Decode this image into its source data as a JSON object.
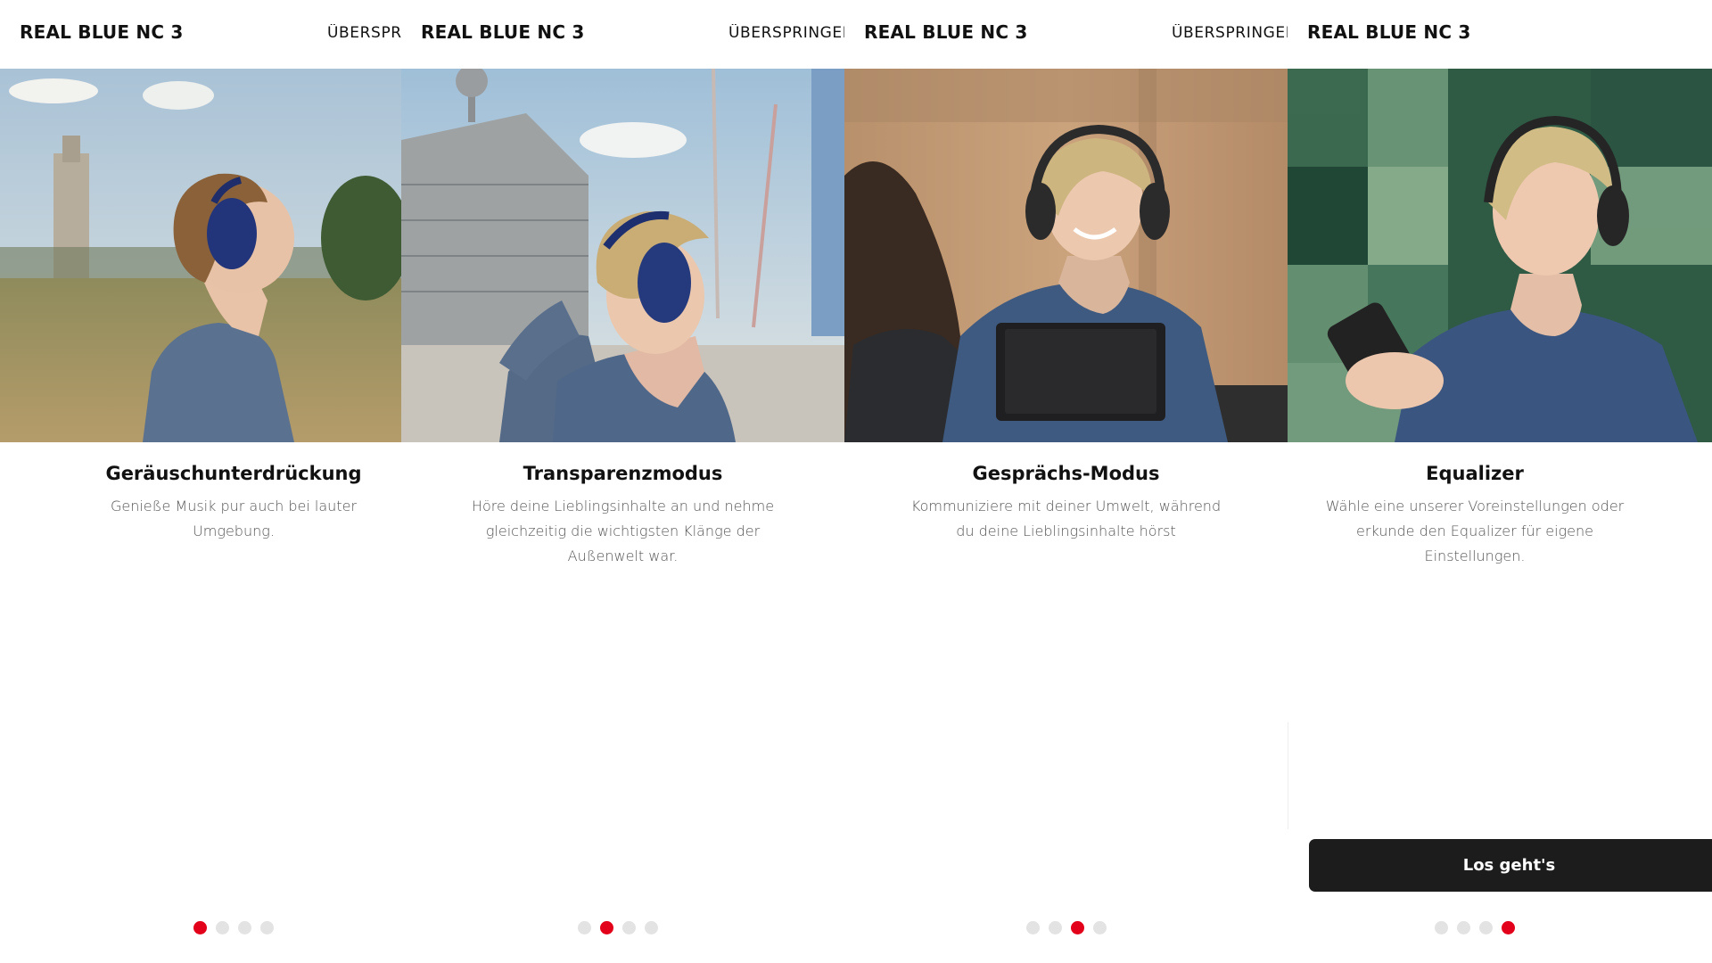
{
  "app": {
    "brand": "REAL BLUE NC 3",
    "skip_label": "ÜBERSPRINGEN"
  },
  "colors": {
    "accent": "#e2001a",
    "cta_background": "#1c1c1c",
    "dot_inactive": "#e3e3e3"
  },
  "slides": [
    {
      "skip_visible": "ÜBERSPRI",
      "title": "Geräuschunterdrückung",
      "desc_lines": [
        "Genieße Musik pur auch bei lauter",
        "Umgebung."
      ],
      "active_dot": 1
    },
    {
      "skip_visible": "ÜBERSPRINGEN",
      "title": "Transparenzmodus",
      "desc_lines": [
        "Höre deine Lieblingsinhalte an und nehme",
        "gleichzeitig die wichtigsten Klänge der",
        "Außenwelt war."
      ],
      "active_dot": 2
    },
    {
      "skip_visible": "ÜBERSPRINGEN",
      "title": "Gesprächs-Modus",
      "desc_lines": [
        "Kommuniziere mit deiner Umwelt, während",
        "du deine Lieblingsinhalte hörst"
      ],
      "active_dot": 3
    },
    {
      "title": "Equalizer",
      "desc_lines": [
        "Wähle eine unserer Voreinstellungen oder",
        "erkunde den Equalizer für eigene",
        "Einstellungen."
      ],
      "active_dot": 4,
      "cta_label": "Los geht's"
    }
  ],
  "pagination": {
    "total": 4
  }
}
